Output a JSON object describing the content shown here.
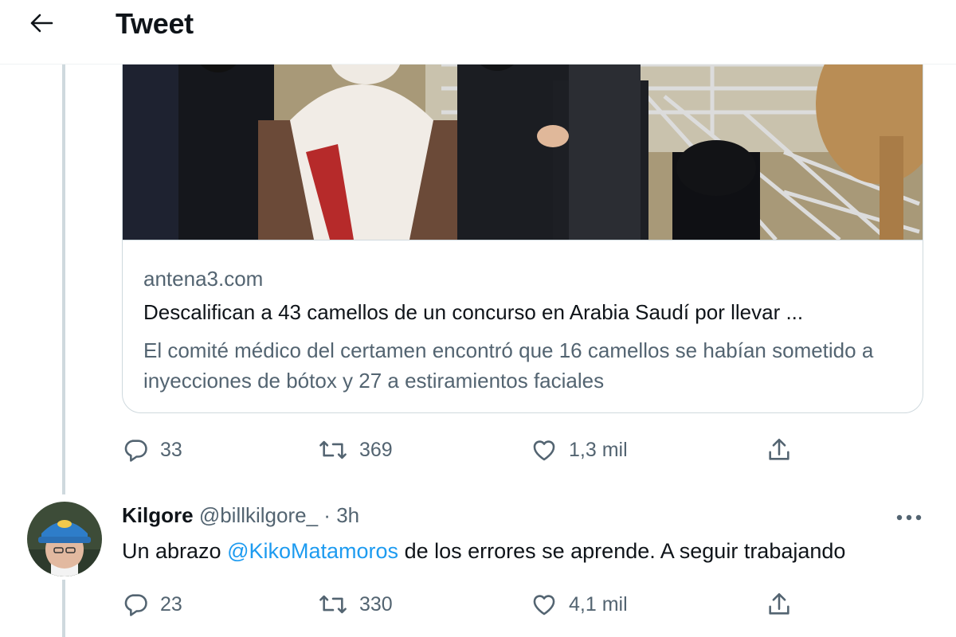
{
  "header": {
    "title": "Tweet",
    "back_icon": "arrow-left-icon"
  },
  "card": {
    "domain": "antena3.com",
    "title": "Descalifican a 43 camellos de un concurso en Arabia Saudí por llevar ...",
    "description": "El comité médico del certamen encontró que 16 camellos se habían sometido a inyecciones de bótox y 27 a estiramientos faciales"
  },
  "main_actions": {
    "replies": "33",
    "retweets": "369",
    "likes": "1,3 mil"
  },
  "reply": {
    "name": "Kilgore",
    "handle": "@billkilgore_",
    "separator": "·",
    "time": "3h",
    "text_before": "Un abrazo ",
    "mention": "@KikoMatamoros",
    "text_after": " de los errores se aprende. A seguir trabajando",
    "actions": {
      "replies": "23",
      "retweets": "330",
      "likes": "4,1 mil"
    }
  },
  "colors": {
    "text": "#0f1419",
    "secondary": "#536471",
    "link": "#1d9bf0",
    "border": "#cfd9de"
  }
}
